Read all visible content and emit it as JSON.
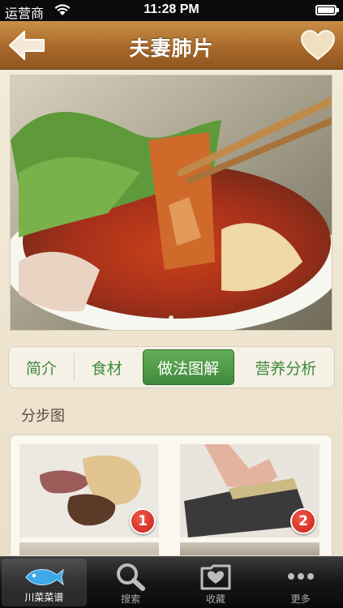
{
  "status_bar": {
    "carrier": "运营商",
    "time": "11:28 PM",
    "icons": [
      "wifi-icon",
      "battery-icon"
    ]
  },
  "nav": {
    "title": "夫妻肺片",
    "back_icon": "back-arrow-icon",
    "favorite_icon": "heart-icon"
  },
  "photo": {
    "page_count": 1
  },
  "tabs": [
    {
      "label": "简介",
      "active": false
    },
    {
      "label": "食材",
      "active": false
    },
    {
      "label": "做法图解",
      "active": true
    },
    {
      "label": "营养分析",
      "active": false
    }
  ],
  "section": {
    "title": "分步图"
  },
  "steps": [
    {
      "number": "1"
    },
    {
      "number": "2"
    }
  ],
  "tabbar": [
    {
      "label": "川菜菜谱",
      "icon": "fish-icon",
      "active": true
    },
    {
      "label": "搜索",
      "icon": "search-icon",
      "active": false
    },
    {
      "label": "收藏",
      "icon": "favorites-folder-icon",
      "active": false
    },
    {
      "label": "更多",
      "icon": "more-dots-icon",
      "active": false
    }
  ],
  "colors": {
    "nav_bar": "#a8692a",
    "tab_active": "#4f9a47",
    "tab_text": "#3e8a3d",
    "badge": "#d8261c"
  }
}
